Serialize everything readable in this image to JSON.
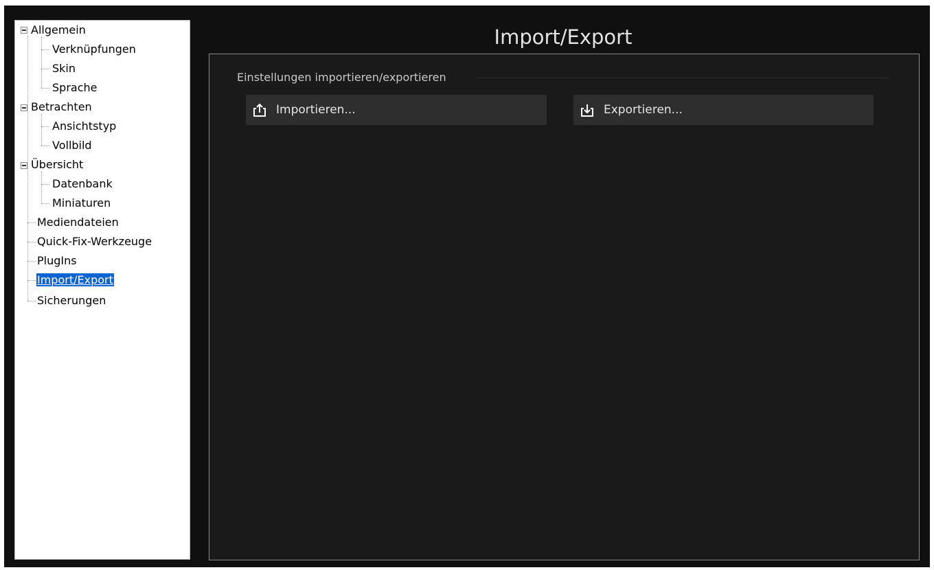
{
  "main": {
    "title": "Import/Export",
    "group_title": "Einstellungen importieren/exportieren",
    "import_label": "Importieren...",
    "export_label": "Exportieren..."
  },
  "sidebar": {
    "items": [
      {
        "label": "Allgemein"
      },
      {
        "label": "Verknüpfungen"
      },
      {
        "label": "Skin"
      },
      {
        "label": "Sprache"
      },
      {
        "label": "Betrachten"
      },
      {
        "label": "Ansichtstyp"
      },
      {
        "label": "Vollbild"
      },
      {
        "label": "Übersicht"
      },
      {
        "label": "Datenbank"
      },
      {
        "label": "Miniaturen"
      },
      {
        "label": "Mediendateien"
      },
      {
        "label": "Quick-Fix-Werkzeuge"
      },
      {
        "label": "PlugIns"
      },
      {
        "label": "Import/Export"
      },
      {
        "label": "Sicherungen"
      }
    ],
    "selected": "Import/Export"
  },
  "icons": {
    "import": "share-upload-icon",
    "export": "download-tray-icon",
    "expander": "collapse-minus-icon"
  },
  "colors": {
    "background": "#101010",
    "panel": "#1a1a1a",
    "button": "#2e2e2e",
    "selection": "#0a64d2"
  }
}
